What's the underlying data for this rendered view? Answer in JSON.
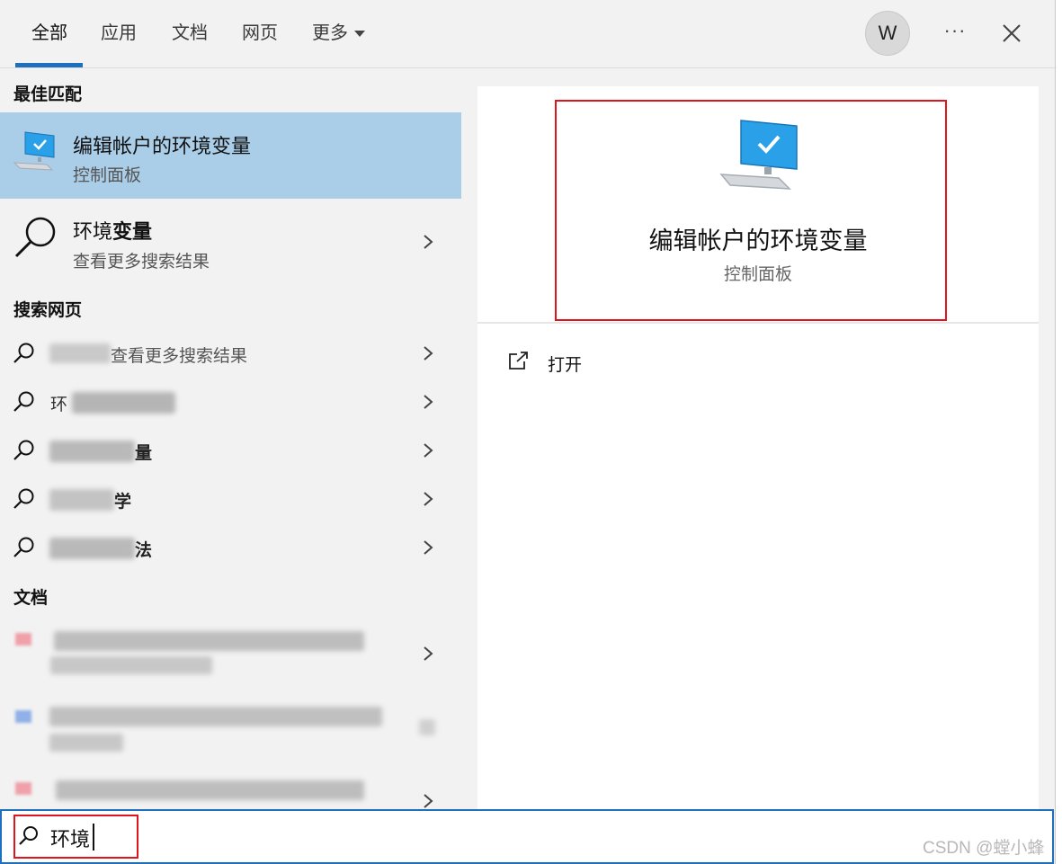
{
  "tabs": [
    {
      "label": "全部"
    },
    {
      "label": "应用"
    },
    {
      "label": "文档"
    },
    {
      "label": "网页"
    },
    {
      "label": "更多"
    }
  ],
  "avatar_letter": "W",
  "more_label": "···",
  "sections": {
    "best_match": "最佳匹配",
    "web": "搜索网页",
    "docs": "文档"
  },
  "best_match_item": {
    "title": "编辑帐户的环境变量",
    "subtitle": "控制面板"
  },
  "env_item": {
    "title_normal": "环境",
    "title_bold": "变量",
    "subtitle": "查看更多搜索结果"
  },
  "web_results": [
    {
      "text_visible": "查看更多搜索结果"
    },
    {
      "text_visible": "环"
    },
    {
      "text_visible": "量"
    },
    {
      "text_visible": "学"
    },
    {
      "text_visible": "法"
    }
  ],
  "preview": {
    "title": "编辑帐户的环境变量",
    "subtitle": "控制面板"
  },
  "action_open": "打开",
  "search": {
    "value": "环境"
  },
  "watermark": "CSDN @螳小蜂",
  "colors": {
    "accent": "#1f6fbf",
    "selected": "#aacde8",
    "highlight": "#e0141c"
  }
}
